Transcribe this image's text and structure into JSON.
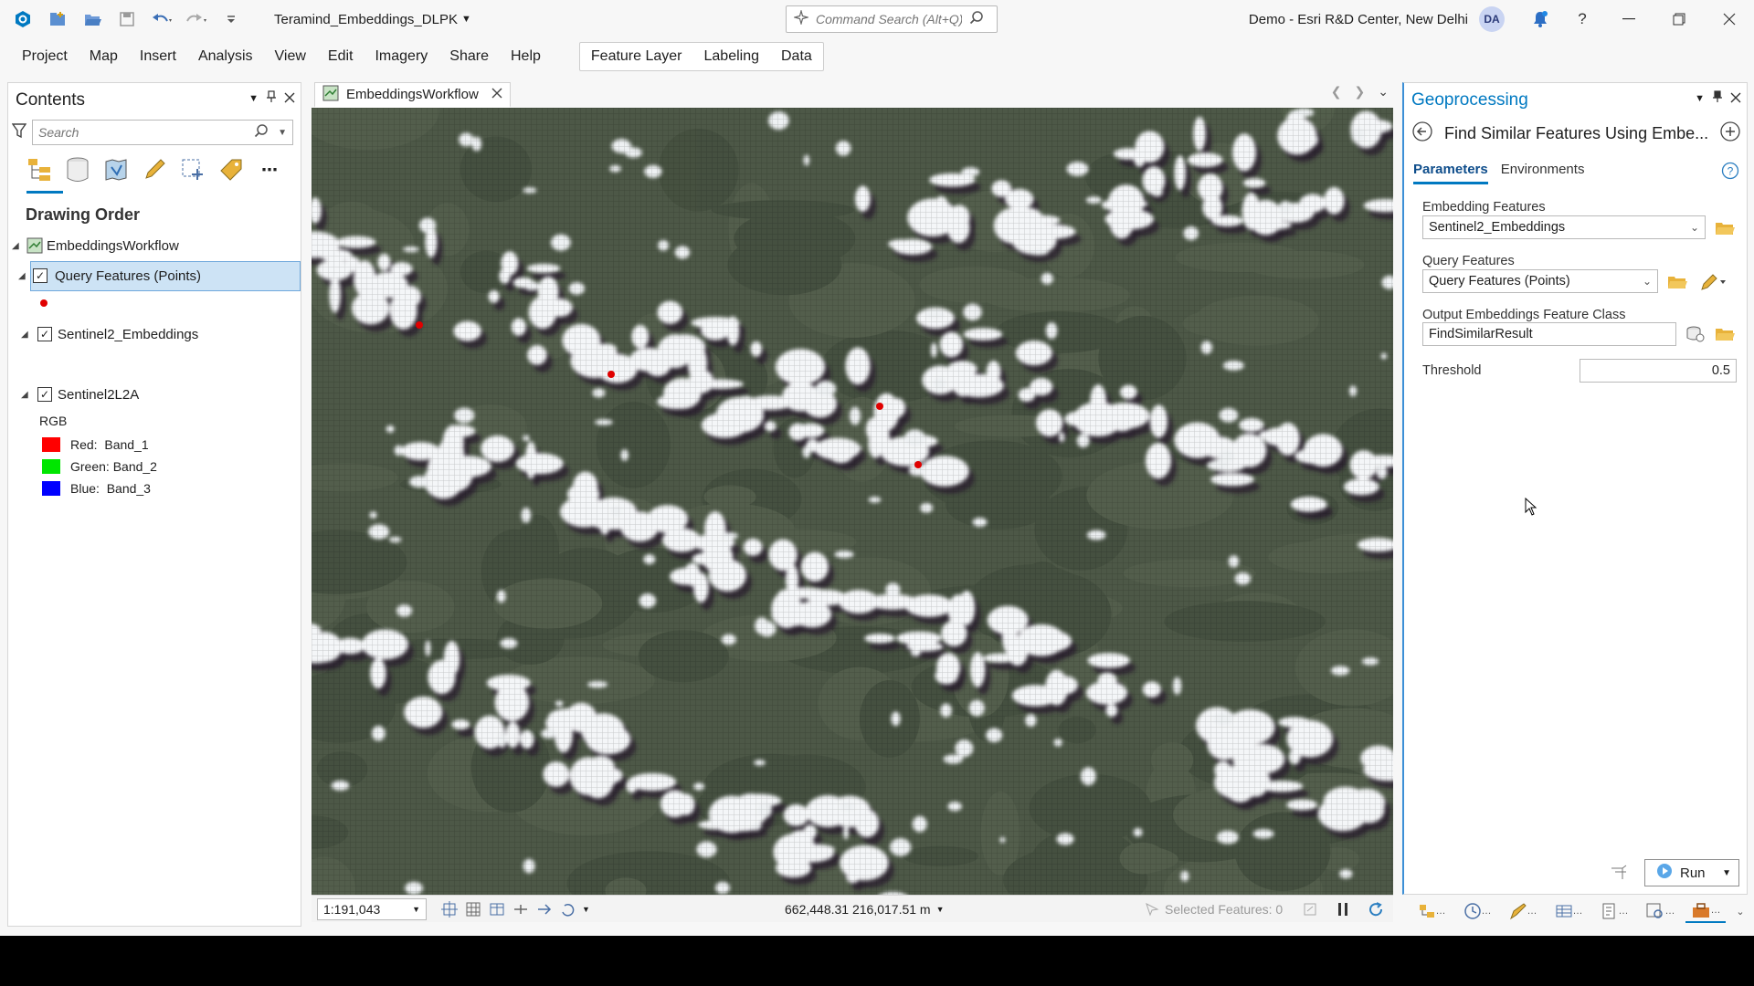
{
  "app": {
    "project_name": "Teramind_Embeddings_DLPK",
    "command_search_placeholder": "Command Search (Alt+Q)",
    "user_label": "Demo - Esri R&D Center, New Delhi",
    "user_initials": "DA"
  },
  "menu": {
    "items": [
      "Project",
      "Map",
      "Insert",
      "Analysis",
      "View",
      "Edit",
      "Imagery",
      "Share",
      "Help"
    ],
    "contextual_tabs": [
      "Feature Layer",
      "Labeling",
      "Data"
    ]
  },
  "contents": {
    "title": "Contents",
    "search_placeholder": "Search",
    "drawing_order": "Drawing Order",
    "map_name": "EmbeddingsWorkflow",
    "layers": [
      {
        "name": "Query Features (Points)",
        "checked": true,
        "selected": true,
        "symbol_color": "#e00000"
      },
      {
        "name": "Sentinel2_Embeddings",
        "checked": true
      },
      {
        "name": "Sentinel2L2A",
        "checked": true
      }
    ],
    "rgb_label": "RGB",
    "bands": [
      {
        "channel": "Red:",
        "band": "Band_1",
        "color": "#ff0000"
      },
      {
        "channel": "Green:",
        "band": "Band_2",
        "color": "#00e600"
      },
      {
        "channel": "Blue:",
        "band": "Band_3",
        "color": "#0000ff"
      }
    ]
  },
  "map": {
    "tab_name": "EmbeddingsWorkflow",
    "scale": "1:191,043",
    "coordinates": "662,448.31 216,017.51 m",
    "selected_features": "Selected Features: 0",
    "query_point_color": "#e00000",
    "query_point_count": 4
  },
  "geoprocessing": {
    "title": "Geoprocessing",
    "tool_name": "Find Similar Features Using Embe...",
    "tabs": [
      "Parameters",
      "Environments"
    ],
    "params": {
      "embedding_features_label": "Embedding Features",
      "embedding_features_value": "Sentinel2_Embeddings",
      "query_features_label": "Query Features",
      "query_features_value": "Query Features (Points)",
      "output_label": "Output Embeddings Feature Class",
      "output_value": "FindSimilarResult",
      "threshold_label": "Threshold",
      "threshold_value": "0.5"
    },
    "run_label": "Run"
  }
}
